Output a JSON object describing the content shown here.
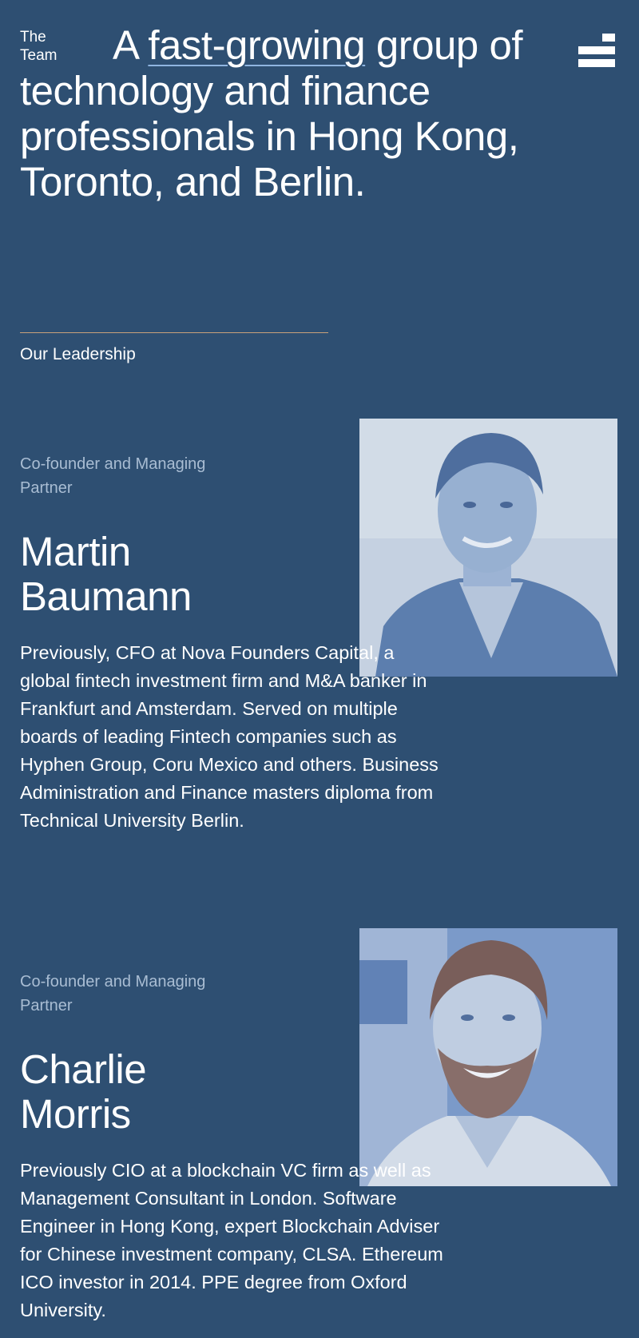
{
  "header": {
    "section_label_line1": "The",
    "section_label_line2": "Team",
    "headline_prefix": "A ",
    "headline_link": "fast-growing",
    "headline_rest": " group of technology and finance professionals in Hong Kong, Toronto, and Berlin.",
    "menu_icon": "hamburger-menu-icon"
  },
  "leadership": {
    "label": "Our Leadership"
  },
  "people": [
    {
      "role": "Co-founder and Managing Partner",
      "name_line1": "Martin",
      "name_line2": "Baumann",
      "bio": "Previously, CFO at Nova Founders Capital, a global fintech investment firm and M&A banker in Frankfurt and Amsterdam. Served on multiple boards of leading Fintech companies such as Hyphen Group, Coru Mexico and others. Business Administration and Finance masters diploma from Technical University Berlin."
    },
    {
      "role": "Co-founder and Managing Partner",
      "name_line1": "Charlie",
      "name_line2": "Morris",
      "bio": "Previously CIO at a blockchain VC firm as well as Management Consultant in London. Software Engineer in Hong Kong, expert Blockchain Adviser for Chinese investment company, CLSA. Ethereum ICO investor in 2014. PPE degree from Oxford University."
    }
  ],
  "colors": {
    "background": "#2e4f72",
    "accent_line": "#c9a27a",
    "role_text": "#a9bdd3",
    "photo_tint": "#6f93c7"
  }
}
